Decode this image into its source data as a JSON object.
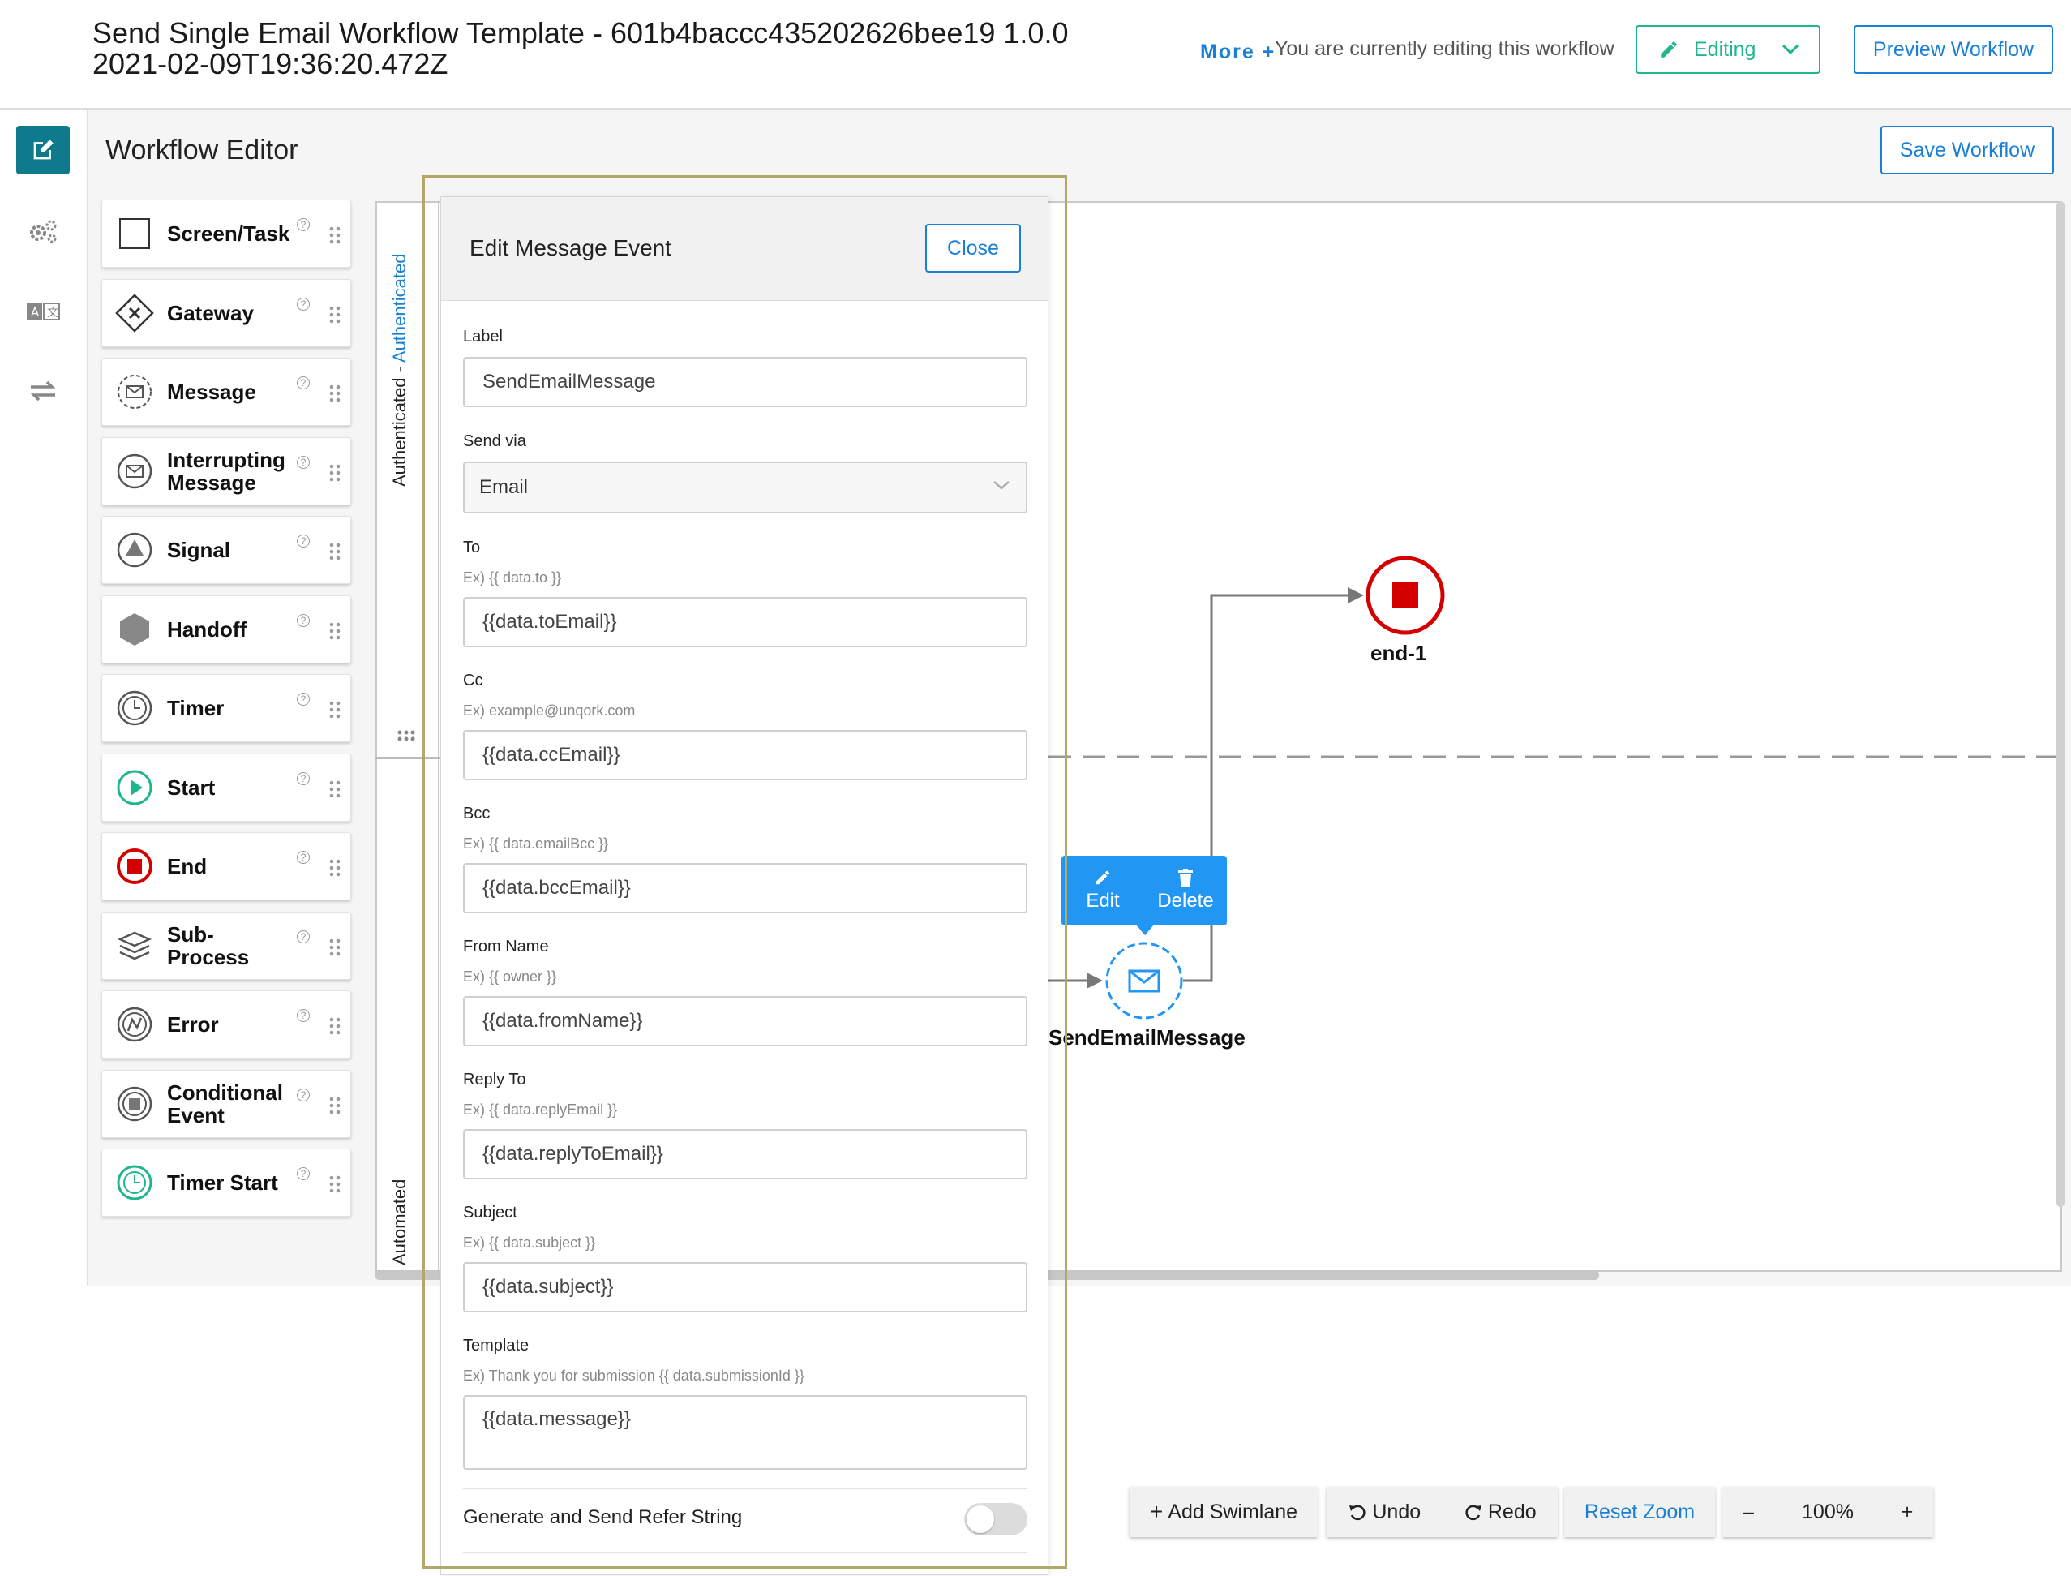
{
  "header": {
    "title": "Send Single Email Workflow Template - 601b4baccc435202626bee19 1.0.0 2021-02-09T19:36:20.472Z",
    "more_label": "More +",
    "editing_note": "You are currently editing this workflow",
    "mode_label": "Editing",
    "preview_label": "Preview Workflow"
  },
  "nav": {
    "icons": [
      "edit-icon",
      "gears-icon",
      "translate-icon",
      "swap-arrows-icon"
    ]
  },
  "editor": {
    "title": "Workflow Editor",
    "save_label": "Save Workflow"
  },
  "palette": {
    "items": [
      {
        "label": "Screen/Task",
        "icon": "square-icon"
      },
      {
        "label": "Gateway",
        "icon": "gateway-icon"
      },
      {
        "label": "Message",
        "icon": "message-icon"
      },
      {
        "label": "Interrupting Message",
        "icon": "interrupting-message-icon"
      },
      {
        "label": "Signal",
        "icon": "signal-icon"
      },
      {
        "label": "Handoff",
        "icon": "handoff-icon"
      },
      {
        "label": "Timer",
        "icon": "timer-icon"
      },
      {
        "label": "Start",
        "icon": "start-icon"
      },
      {
        "label": "End",
        "icon": "end-icon"
      },
      {
        "label": "Sub-Process",
        "icon": "sub-process-icon"
      },
      {
        "label": "Error",
        "icon": "error-icon"
      },
      {
        "label": "Conditional Event",
        "icon": "conditional-event-icon"
      },
      {
        "label": "Timer Start",
        "icon": "timer-start-icon"
      }
    ],
    "help_glyph": "?"
  },
  "canvas": {
    "lane1_label_a": "Authenticated - ",
    "lane1_label_b": "Authenticated",
    "lane2_label": "Automated",
    "end_node_label": "end-1",
    "message_node_label": "SendEmailMessage",
    "context_menu": {
      "edit_label": "Edit",
      "delete_label": "Delete"
    },
    "colors": {
      "end": "#d40000",
      "accent": "#2196f3",
      "teal": "#1fb58f"
    }
  },
  "panel": {
    "title": "Edit Message Event",
    "close_label": "Close",
    "fields": {
      "label": {
        "label": "Label",
        "value": "SendEmailMessage"
      },
      "send_via": {
        "label": "Send via",
        "value": "Email"
      },
      "to": {
        "label": "To",
        "hint": "Ex) {{ data.to }}",
        "value": "{{data.toEmail}}"
      },
      "cc": {
        "label": "Cc",
        "hint": "Ex) example@unqork.com",
        "value": "{{data.ccEmail}}"
      },
      "bcc": {
        "label": "Bcc",
        "hint": "Ex) {{ data.emailBcc }}",
        "value": "{{data.bccEmail}}"
      },
      "from_name": {
        "label": "From Name",
        "hint": "Ex) {{ owner }}",
        "value": "{{data.fromName}}"
      },
      "reply_to": {
        "label": "Reply To",
        "hint": "Ex) {{ data.replyEmail }}",
        "value": "{{data.replyToEmail}}"
      },
      "subject": {
        "label": "Subject",
        "hint": "Ex) {{ data.subject }}",
        "value": "{{data.subject}}"
      },
      "template": {
        "label": "Template",
        "hint": "Ex) Thank you for submission {{ data.submissionId }}",
        "value": "{{data.message}}"
      }
    },
    "toggle": {
      "label": "Generate and Send Refer String",
      "on": false
    }
  },
  "toolbar": {
    "add_swimlane": "Add Swimlane",
    "undo": "Undo",
    "redo": "Redo",
    "reset_zoom": "Reset Zoom",
    "zoom_out": "–",
    "zoom_level": "100%",
    "zoom_in": "+"
  }
}
